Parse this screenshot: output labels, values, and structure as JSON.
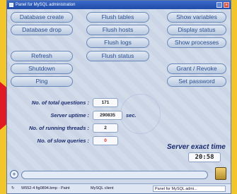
{
  "window": {
    "title": "Panel for MySQL administration",
    "min_glyph": "_",
    "close_glyph": "×"
  },
  "buttons": {
    "database_create": "Database create",
    "database_drop": "Database drop",
    "flush_tables": "Flush tables",
    "flush_hosts": "Flush hosts",
    "flush_logs": "Flush logs",
    "flush_status": "Flush status",
    "show_variables": "Show variables",
    "display_status": "Display status",
    "show_processes": "Show processes",
    "refresh": "Refresh",
    "shutdown": "Shutdown",
    "ping": "Ping",
    "grant_revoke": "Grant / Revoke",
    "set_password": "Set password"
  },
  "stats": {
    "total_questions_label": "No. of total questions :",
    "total_questions_value": "171",
    "server_uptime_label": "Server uptime :",
    "server_uptime_value": "290835",
    "server_uptime_unit": "sec.",
    "running_threads_label": "No. of running threads :",
    "running_threads_value": "2",
    "slow_queries_label": "No. of slow queries :",
    "slow_queries_value": "0",
    "server_exact_time_label": "Server exact time",
    "server_exact_time_value": "20:58"
  },
  "taskbar": {
    "start_glyph": "↻",
    "item1": "W552-4 fig0894.bmp - Paint",
    "item2": "MySQL client",
    "item3": "Panel for MySQL admi..."
  },
  "controls": {
    "scroll_plus": "+"
  },
  "colors": {
    "background": "#f2c62a",
    "arrow": "#e11b24",
    "window_bg": "#cfd9ea",
    "button_text": "#2a4f90",
    "label_text": "#1b2c6e",
    "slow_queries_value": "#e2281c"
  }
}
